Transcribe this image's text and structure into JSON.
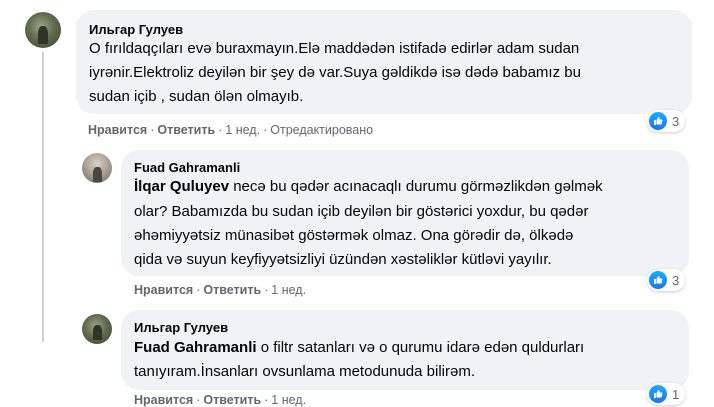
{
  "comments": [
    {
      "author": "Ильгар Гулуев",
      "lines": [
        "O fırıldaqçıları evə buraxmayın.Elə maddədən istifadə edirlər adam sudan",
        "iyrənir.Elektroliz deyilən bir şey də var.Suya gəldikdə isə dədə babamız bu",
        "sudan içib , sudan ölən olmayıb."
      ],
      "like_label": "Нравится",
      "reply_label": "Ответить",
      "time": "1 нед.",
      "edited": "Отредактировано",
      "reaction_count": "3"
    },
    {
      "author": "Fuad Gahramanli",
      "mention": "İlqar Quluyev",
      "lines": [
        " necə bu qədər acınacaqlı durumu görməzlikdən gəlmək",
        "olar? Babamızda bu sudan içib deyilən bir göstərici yoxdur, bu qədər",
        "əhəmiyyətsiz münasibət göstərmək olmaz. Ona görədir də, ölkədə",
        "qida və suyun keyfiyyətsizliyi üzündən xəstəliklər kütləvi yayılır."
      ],
      "like_label": "Нравится",
      "reply_label": "Ответить",
      "time": "1 нед.",
      "reaction_count": "3"
    },
    {
      "author": "Ильгар Гулуев",
      "mention": "Fuad Gahramanli",
      "lines": [
        " o filtr satanları və o qurumu idarə edən quldurları",
        "tanıyıram.İnsanları ovsunlama metodunuda bilirəm."
      ],
      "like_label": "Нравится",
      "reply_label": "Ответить",
      "time": "1 нед.",
      "reaction_count": "1"
    }
  ]
}
